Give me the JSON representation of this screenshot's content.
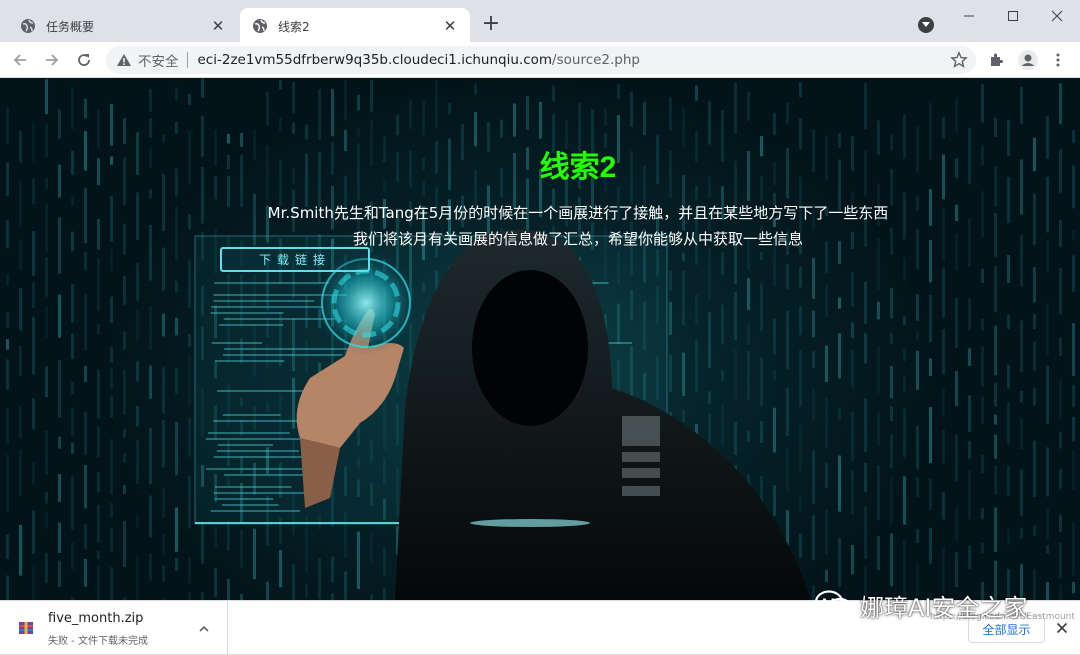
{
  "browser": {
    "tabs": [
      {
        "title": "任务概要",
        "active": false
      },
      {
        "title": "线索2",
        "active": true
      }
    ],
    "new_tab_label": "+",
    "address": {
      "security_label": "不安全",
      "host": "eci-2ze1vm55dfrberw9q35b.cloudeci1.ichunqiu.com",
      "path": "/source2.php"
    }
  },
  "page": {
    "heading": "线索2",
    "line1": "Mr.Smith先生和Tang在5月份的时候在一个画展进行了接触，并且在某些地方写下了一些东西",
    "line2": "我们将该月有关画展的信息做了汇总，希望你能够从中获取一些信息",
    "download_link": "下载链接",
    "colors": {
      "heading": "#22ff00",
      "accent": "#5de0ea"
    }
  },
  "downloads": {
    "items": [
      {
        "filename": "five_month.zip",
        "status": "失败 - 文件下载未完成"
      }
    ],
    "show_all_label": "全部显示"
  },
  "overlay": {
    "watermark": "娜璋AI安全之家",
    "csdn_text": "https://blog.csdn.net/Eastmount"
  }
}
